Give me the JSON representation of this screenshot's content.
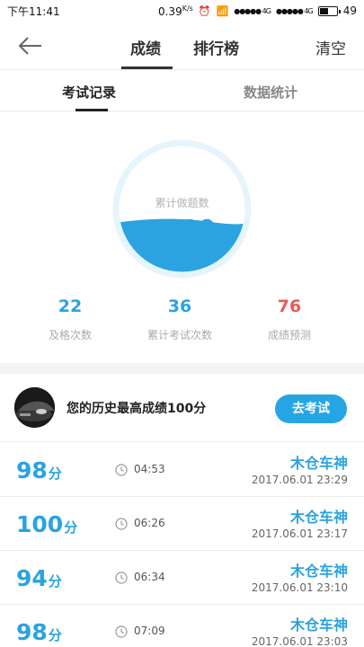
{
  "status": {
    "time": "下午11:41",
    "speed": "0.39",
    "speed_unit": "K/s",
    "network_1": "4G",
    "network_2": "4G",
    "battery": "49"
  },
  "nav": {
    "tab_scores": "成绩",
    "tab_ranking": "排行榜",
    "clear_label": "清空"
  },
  "subtabs": {
    "records": "考试记录",
    "statistics": "数据统计"
  },
  "summary": {
    "total_label": "累计做题数",
    "total_value": "1919",
    "wave_fill_fraction": 0.38,
    "stats": [
      {
        "value": "22",
        "label": "及格次数"
      },
      {
        "value": "36",
        "label": "累计考试次数"
      },
      {
        "value": "76",
        "label": "成绩预测"
      }
    ]
  },
  "best": {
    "text": "您的历史最高成绩100分",
    "button": "去考试"
  },
  "records": [
    {
      "score": "98",
      "unit": "分",
      "duration": "04:53",
      "title": "木仓车神",
      "date": "2017.06.01  23:29"
    },
    {
      "score": "100",
      "unit": "分",
      "duration": "06:26",
      "title": "木仓车神",
      "date": "2017.06.01  23:17"
    },
    {
      "score": "94",
      "unit": "分",
      "duration": "06:34",
      "title": "木仓车神",
      "date": "2017.06.01  23:10"
    },
    {
      "score": "98",
      "unit": "分",
      "duration": "07:09",
      "title": "木仓车神",
      "date": "2017.06.01  23:03"
    }
  ],
  "colors": {
    "accent": "#2aa3e0",
    "button": "#26a5e4",
    "prediction": "#ec5a54"
  }
}
